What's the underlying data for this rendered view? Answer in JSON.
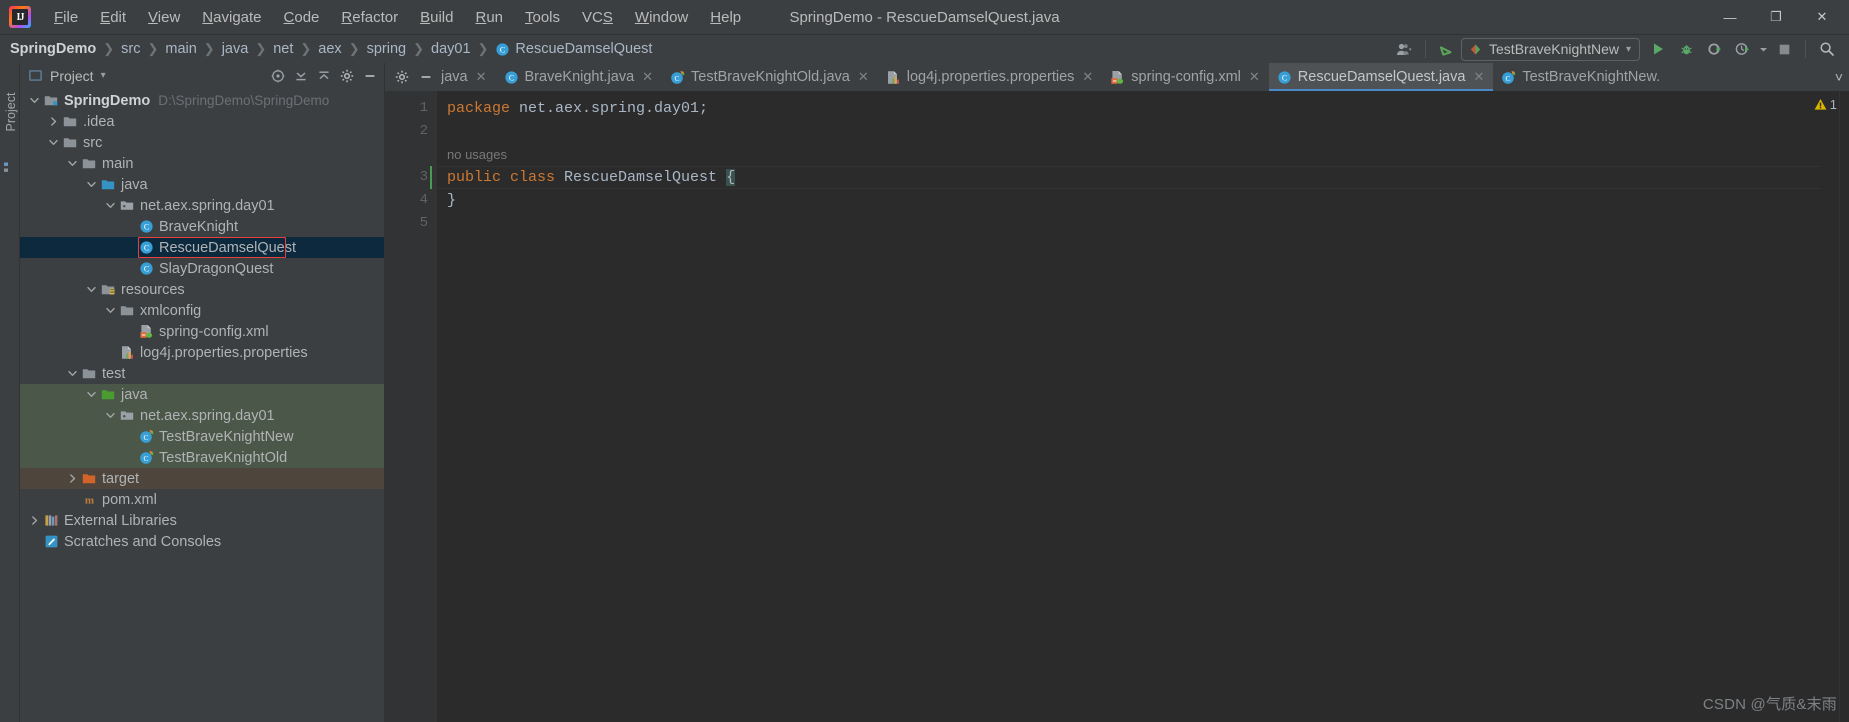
{
  "window": {
    "title": "SpringDemo - RescueDamselQuest.java",
    "logo_text": "IJ",
    "controls": {
      "minimize": "—",
      "maximize": "❐",
      "close": "✕"
    }
  },
  "menu": {
    "items": [
      {
        "label": "File",
        "mnemonic": "F",
        "rest": "ile"
      },
      {
        "label": "Edit",
        "mnemonic": "E",
        "rest": "dit"
      },
      {
        "label": "View",
        "mnemonic": "V",
        "rest": "iew"
      },
      {
        "label": "Navigate",
        "mnemonic": "N",
        "rest": "avigate"
      },
      {
        "label": "Code",
        "mnemonic": "C",
        "rest": "ode"
      },
      {
        "label": "Refactor",
        "mnemonic": "R",
        "rest": "efactor"
      },
      {
        "label": "Build",
        "mnemonic": "B",
        "rest": "uild"
      },
      {
        "label": "Run",
        "mnemonic": "R",
        "rest": "un"
      },
      {
        "label": "Tools",
        "mnemonic": "T",
        "rest": "ools"
      },
      {
        "label": "VCS",
        "mnemonic": "S",
        "rest": "VCS"
      },
      {
        "label": "Window",
        "mnemonic": "W",
        "rest": "indow"
      },
      {
        "label": "Help",
        "mnemonic": "H",
        "rest": "elp"
      }
    ]
  },
  "breadcrumb": {
    "separator": "❯",
    "items": [
      {
        "label": "SpringDemo",
        "icon": "none"
      },
      {
        "label": "src",
        "icon": "none"
      },
      {
        "label": "main",
        "icon": "none"
      },
      {
        "label": "java",
        "icon": "none"
      },
      {
        "label": "net",
        "icon": "none"
      },
      {
        "label": "aex",
        "icon": "none"
      },
      {
        "label": "spring",
        "icon": "none"
      },
      {
        "label": "day01",
        "icon": "none"
      },
      {
        "label": "RescueDamselQuest",
        "icon": "java-class-icon"
      }
    ]
  },
  "toolbar": {
    "run_config_label": "TestBraveKnightNew",
    "run_config_dropdown": "▾",
    "buttons": [
      {
        "name": "account-icon",
        "label": "Account"
      },
      {
        "name": "update-project-icon",
        "label": "Update Project"
      },
      {
        "name": "run-icon",
        "label": "Run"
      },
      {
        "name": "debug-icon",
        "label": "Debug"
      },
      {
        "name": "run-with-coverage-icon",
        "label": "Run with Coverage"
      },
      {
        "name": "profiler-icon",
        "label": "Profiler"
      },
      {
        "name": "stop-icon",
        "label": "Stop"
      },
      {
        "name": "search-everywhere-icon",
        "label": "Search Everywhere"
      }
    ],
    "accent_green": "#499c54",
    "accent_blue": "#4a88c7"
  },
  "left_strip": {
    "label": "Project"
  },
  "project_panel": {
    "title": "Project",
    "title_dropdown": "▾",
    "actions": [
      {
        "name": "settings-gear-icon",
        "label": "Settings"
      },
      {
        "name": "collapse-all-icon",
        "label": "Collapse All"
      },
      {
        "name": "expand-all-icon",
        "label": "Expand All"
      },
      {
        "name": "hide-panel-icon",
        "label": "Hide"
      }
    ],
    "tree": [
      {
        "label": "SpringDemo",
        "sub": "D:\\SpringDemo\\SpringDemo",
        "depth": 0,
        "arrow": "down",
        "icon": "project-module-icon",
        "bold": true,
        "bg": "none"
      },
      {
        "label": ".idea",
        "sub": "",
        "depth": 1,
        "arrow": "right",
        "icon": "folder-icon",
        "bold": false,
        "bg": "none"
      },
      {
        "label": "src",
        "sub": "",
        "depth": 1,
        "arrow": "down",
        "icon": "folder-icon",
        "bold": false,
        "bg": "none"
      },
      {
        "label": "main",
        "sub": "",
        "depth": 2,
        "arrow": "down",
        "icon": "folder-icon",
        "bold": false,
        "bg": "none"
      },
      {
        "label": "java",
        "sub": "",
        "depth": 3,
        "arrow": "down",
        "icon": "source-root-icon",
        "bold": false,
        "bg": "none"
      },
      {
        "label": "net.aex.spring.day01",
        "sub": "",
        "depth": 4,
        "arrow": "down",
        "icon": "package-icon",
        "bold": false,
        "bg": "none"
      },
      {
        "label": "BraveKnight",
        "sub": "",
        "depth": 5,
        "arrow": "none",
        "icon": "java-class-icon",
        "bold": false,
        "bg": "none"
      },
      {
        "label": "RescueDamselQuest",
        "sub": "",
        "depth": 5,
        "arrow": "none",
        "icon": "java-class-icon",
        "bold": false,
        "bg": "selected",
        "highlight": true
      },
      {
        "label": "SlayDragonQuest",
        "sub": "",
        "depth": 5,
        "arrow": "none",
        "icon": "java-class-icon",
        "bold": false,
        "bg": "none"
      },
      {
        "label": "resources",
        "sub": "",
        "depth": 3,
        "arrow": "down",
        "icon": "resource-root-icon",
        "bold": false,
        "bg": "none"
      },
      {
        "label": "xmlconfig",
        "sub": "",
        "depth": 4,
        "arrow": "down",
        "icon": "folder-icon",
        "bold": false,
        "bg": "none"
      },
      {
        "label": "spring-config.xml",
        "sub": "",
        "depth": 5,
        "arrow": "none",
        "icon": "spring-xml-icon",
        "bold": false,
        "bg": "none"
      },
      {
        "label": "log4j.properties.properties",
        "sub": "",
        "depth": 4,
        "arrow": "none",
        "icon": "properties-file-icon",
        "bold": false,
        "bg": "none"
      },
      {
        "label": "test",
        "sub": "",
        "depth": 2,
        "arrow": "down",
        "icon": "folder-icon",
        "bold": false,
        "bg": "none"
      },
      {
        "label": "java",
        "sub": "",
        "depth": 3,
        "arrow": "down",
        "icon": "test-source-root-icon",
        "bold": false,
        "bg": "green"
      },
      {
        "label": "net.aex.spring.day01",
        "sub": "",
        "depth": 4,
        "arrow": "down",
        "icon": "package-icon",
        "bold": false,
        "bg": "green"
      },
      {
        "label": "TestBraveKnightNew",
        "sub": "",
        "depth": 5,
        "arrow": "none",
        "icon": "test-class-icon",
        "bold": false,
        "bg": "green"
      },
      {
        "label": "TestBraveKnightOld",
        "sub": "",
        "depth": 5,
        "arrow": "none",
        "icon": "test-class-icon",
        "bold": false,
        "bg": "green"
      },
      {
        "label": "target",
        "sub": "",
        "depth": 2,
        "arrow": "right",
        "icon": "excluded-folder-icon",
        "bold": false,
        "bg": "brown"
      },
      {
        "label": "pom.xml",
        "sub": "",
        "depth": 2,
        "arrow": "none",
        "icon": "maven-pom-icon",
        "bold": false,
        "bg": "none"
      },
      {
        "label": "External Libraries",
        "sub": "",
        "depth": 0,
        "arrow": "right",
        "icon": "external-libraries-icon",
        "bold": false,
        "bg": "none"
      },
      {
        "label": "Scratches and Consoles",
        "sub": "",
        "depth": 0,
        "arrow": "none",
        "icon": "scratches-icon",
        "bold": false,
        "bg": "none"
      }
    ]
  },
  "editor": {
    "tab_tools": [
      {
        "name": "settings-gear-icon",
        "label": "Settings"
      },
      {
        "name": "hide-editor-icon",
        "label": "Hide"
      }
    ],
    "tabs": [
      {
        "label": "java",
        "icon": "java-class-icon",
        "active": false,
        "clipped": true,
        "close": "✕"
      },
      {
        "label": "BraveKnight.java",
        "icon": "java-class-icon",
        "active": false,
        "clipped": false,
        "close": "✕"
      },
      {
        "label": "TestBraveKnightOld.java",
        "icon": "test-class-icon",
        "active": false,
        "clipped": false,
        "close": "✕"
      },
      {
        "label": "log4j.properties.properties",
        "icon": "properties-file-icon",
        "active": false,
        "clipped": false,
        "close": "✕"
      },
      {
        "label": "spring-config.xml",
        "icon": "spring-xml-icon",
        "active": false,
        "clipped": false,
        "close": "✕"
      },
      {
        "label": "RescueDamselQuest.java",
        "icon": "java-class-icon",
        "active": true,
        "clipped": false,
        "close": "✕"
      },
      {
        "label": "TestBraveKnightNew.",
        "icon": "test-class-icon",
        "active": false,
        "clipped": false,
        "close": ""
      }
    ],
    "tabs_overflow": "˅",
    "gutter_numbers": [
      "1",
      "2",
      "3",
      "4",
      "5"
    ],
    "inlay_hint": "no usages",
    "code_lines": [
      {
        "tokens": [
          {
            "t": "package ",
            "c": "kw"
          },
          {
            "t": "net.aex.spring.day01;",
            "c": "plain"
          }
        ]
      },
      {
        "tokens": []
      },
      {
        "tokens": [
          {
            "t": "public ",
            "c": "kw"
          },
          {
            "t": "class ",
            "c": "kw"
          },
          {
            "t": "RescueDamselQuest ",
            "c": "cls"
          },
          {
            "t": "{",
            "c": "brace"
          }
        ]
      },
      {
        "tokens": [
          {
            "t": "}",
            "c": "brace"
          }
        ]
      },
      {
        "tokens": []
      }
    ],
    "warning_count": "1",
    "warning_icon": "warning-triangle-icon"
  },
  "watermark": {
    "text": "CSDN @气质&末雨"
  },
  "colors": {
    "background": "#3c3f41",
    "editor_background": "#2b2b2b",
    "gutter": "#313335",
    "selection": "#0d293e",
    "test_root_green": "#4b5748",
    "excluded_brown": "#4e463c",
    "keyword_orange": "#cc7832",
    "text": "#a9b7c6",
    "annotation_red": "#e8403a",
    "tab_active": "#4e5254"
  }
}
